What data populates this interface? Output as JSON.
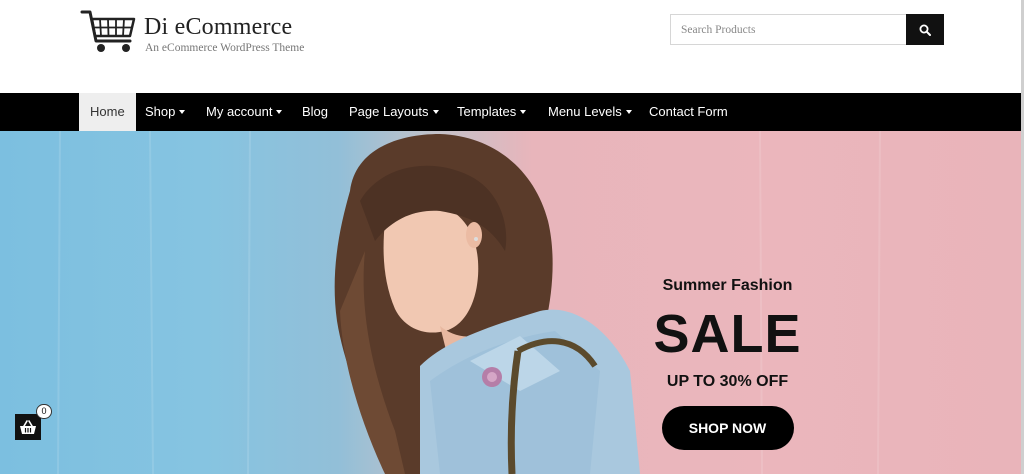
{
  "site": {
    "title": "Di eCommerce",
    "tagline": "An eCommerce WordPress Theme"
  },
  "search": {
    "placeholder": "Search Products",
    "value": ""
  },
  "nav": {
    "items": [
      {
        "label": "Home",
        "active": true,
        "has_dropdown": false
      },
      {
        "label": "Shop",
        "active": false,
        "has_dropdown": true
      },
      {
        "label": "My account",
        "active": false,
        "has_dropdown": true
      },
      {
        "label": "Blog",
        "active": false,
        "has_dropdown": false
      },
      {
        "label": "Page Layouts",
        "active": false,
        "has_dropdown": true
      },
      {
        "label": "Templates",
        "active": false,
        "has_dropdown": true
      },
      {
        "label": "Menu Levels",
        "active": false,
        "has_dropdown": true
      },
      {
        "label": "Contact Form",
        "active": false,
        "has_dropdown": false
      }
    ]
  },
  "hero": {
    "subtitle": "Summer Fashion",
    "headline": "SALE",
    "offer": "UP TO 30% OFF",
    "cta_label": "SHOP NOW"
  },
  "mini_cart": {
    "count": "0"
  },
  "icons": {
    "logo": "shopping-cart-icon",
    "search": "magnifier-icon",
    "mini_cart": "shopping-basket-icon"
  },
  "colors": {
    "nav_bg": "#000000",
    "active_item_bg": "#eeeeee",
    "hero_left": "#86c4e1",
    "hero_right": "#ebb6bc",
    "cta_bg": "#000000"
  }
}
